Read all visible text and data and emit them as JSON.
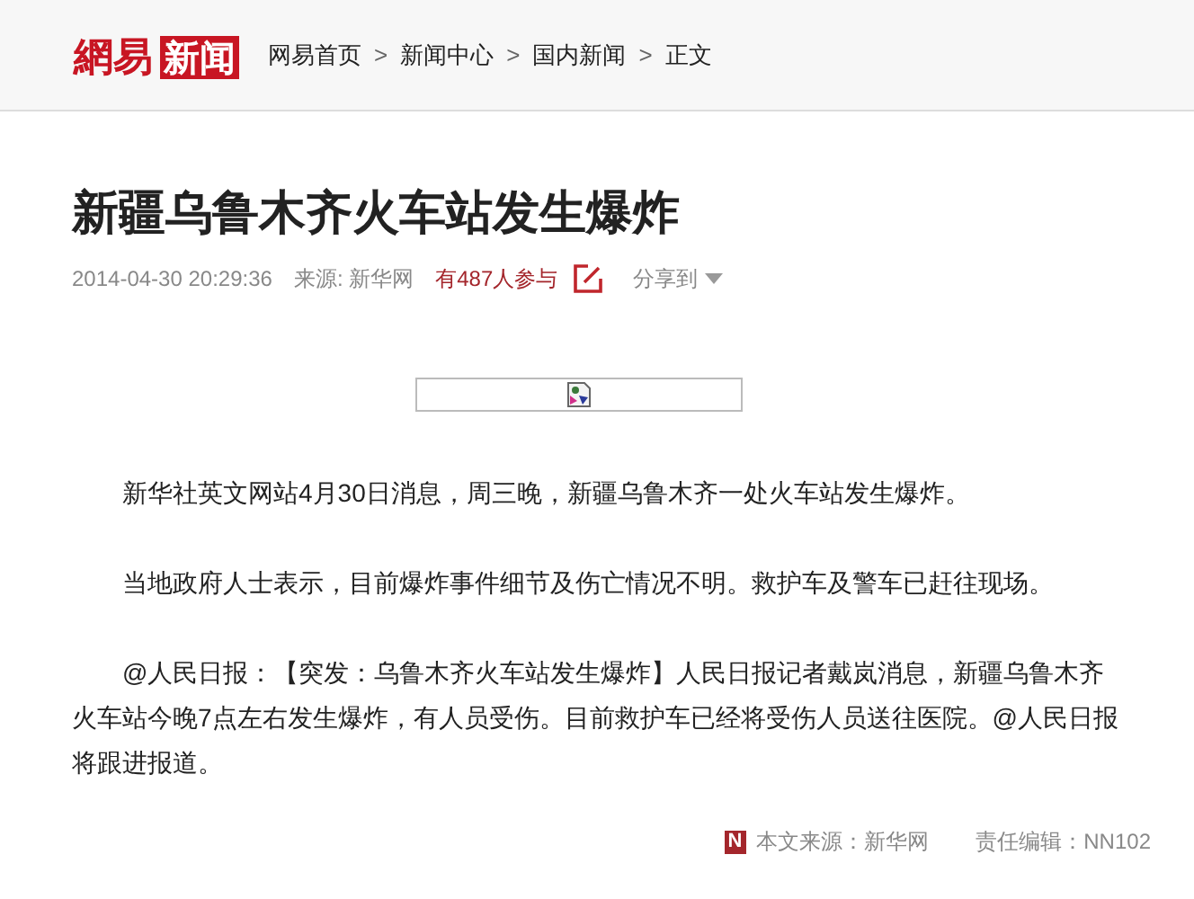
{
  "header": {
    "logo": {
      "part_1": "網易",
      "part_2": "新闻"
    },
    "breadcrumb": [
      {
        "label": "网易首页"
      },
      {
        "label": "新闻中心"
      },
      {
        "label": "国内新闻"
      },
      {
        "label": "正文"
      }
    ],
    "separator": ">"
  },
  "article": {
    "title": "新疆乌鲁木齐火车站发生爆炸",
    "meta": {
      "time": "2014-04-30 20:29:36",
      "source": "来源: 新华网",
      "participants": "有487人参与",
      "share": "分享到"
    },
    "image": {
      "kind": "broken-image"
    },
    "paragraphs": [
      "新华社英文网站4月30日消息，周三晚，新疆乌鲁木齐一处火车站发生爆炸。",
      "当地政府人士表示，目前爆炸事件细节及伤亡情况不明。救护车及警车已赶往现场。",
      "@人民日报：【突发：乌鲁木齐火车站发生爆炸】人民日报记者戴岚消息，新疆乌鲁木齐火车站今晚7点左右发生爆炸，有人员受伤。目前救护车已经将受伤人员送往医院。@人民日报将跟进报道。"
    ],
    "footer": {
      "badge": "N",
      "source": "本文来源：新华网",
      "editor": "责任编辑：NN102"
    }
  }
}
